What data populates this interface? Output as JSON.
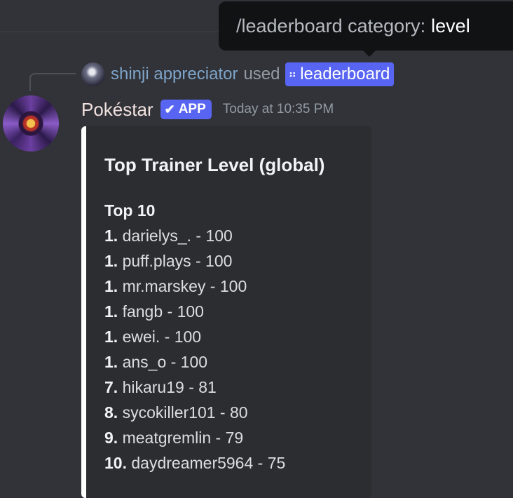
{
  "tooltip": {
    "command": "/leaderboard category:",
    "value": "level"
  },
  "reply": {
    "user": "shinji appreciator",
    "used_text": "used",
    "command_icon": "app-command-icon",
    "command_name": "leaderboard"
  },
  "message": {
    "author": "Pokéstar",
    "badge": "APP",
    "badge_icon": "checkmark-icon",
    "timestamp": "Today at 10:35 PM"
  },
  "embed": {
    "accent_color": "#ffffff",
    "title": "Top Trainer Level (global)",
    "field_name": "Top 10",
    "entries": [
      {
        "rank": "1.",
        "text": "darielys_. - 100"
      },
      {
        "rank": "1.",
        "text": "puff.plays - 100"
      },
      {
        "rank": "1.",
        "text": "mr.marskey - 100"
      },
      {
        "rank": "1.",
        "text": "fangb - 100"
      },
      {
        "rank": "1.",
        "text": "ewei. - 100"
      },
      {
        "rank": "1.",
        "text": "ans_o - 100"
      },
      {
        "rank": "7.",
        "text": "hikaru19 - 81"
      },
      {
        "rank": "8.",
        "text": "sycokiller101 - 80"
      },
      {
        "rank": "9.",
        "text": "meatgremlin - 79"
      },
      {
        "rank": "10.",
        "text": "daydreamer5964 - 75"
      }
    ]
  },
  "colors": {
    "background": "#313338",
    "blurple": "#5865f2",
    "embed_background": "#2b2d31"
  }
}
